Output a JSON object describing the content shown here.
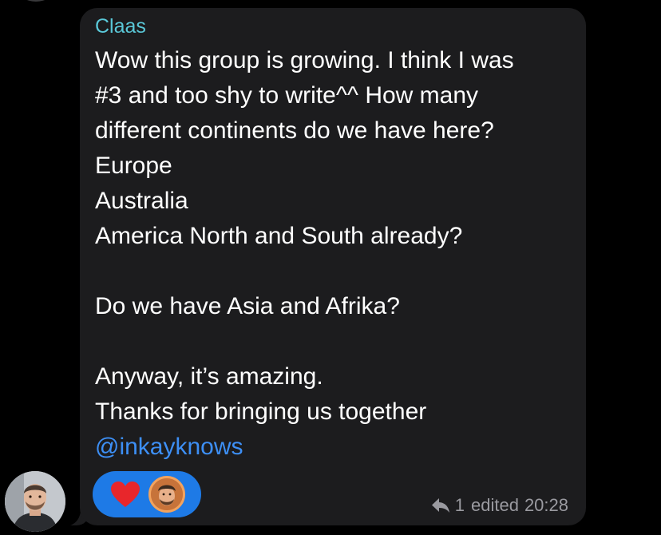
{
  "message": {
    "sender_name": "Claas",
    "lines": [
      "Wow this group is growing. I think I was",
      "#3 and too shy to write^^ How many",
      "different continents do we have here?",
      "Europe",
      "Australia",
      "America North and South already?",
      "",
      "Do we have Asia and Afrika?",
      "",
      "Anyway, it’s amazing.",
      "Thanks for bringing us together"
    ],
    "mention": "@inkayknows",
    "reply_count": "1",
    "edited_label": "edited",
    "time": "20:28"
  },
  "reactions": {
    "emoji_icon": "heart-icon",
    "reactor_avatar": "reactor-avatar"
  },
  "colors": {
    "background": "#000000",
    "bubble": "#1c1c1e",
    "sender_name": "#5ac8d8",
    "mention": "#3d8ff5",
    "reaction_pill": "#1e7ae6",
    "meta_text": "#9a9aa0",
    "heart": "#e8262b"
  }
}
